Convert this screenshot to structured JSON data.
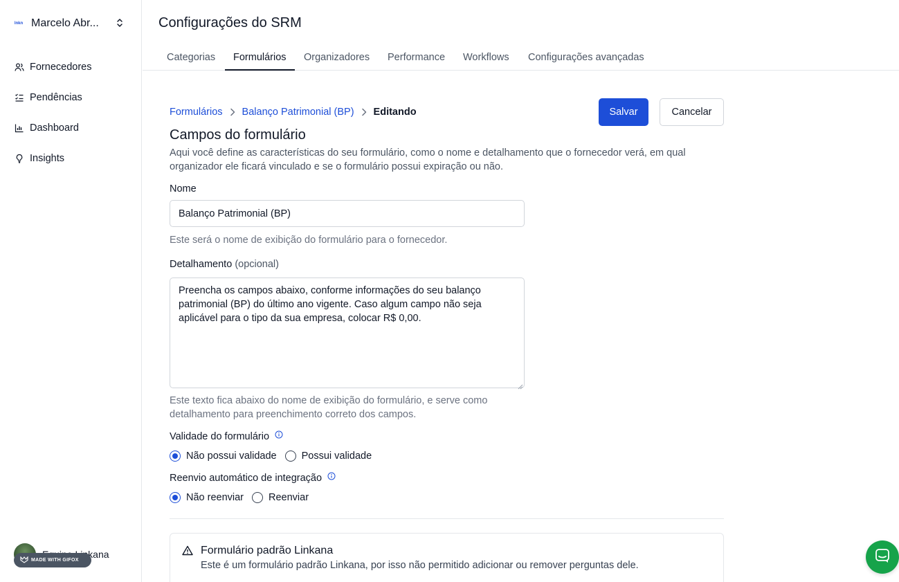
{
  "sidebar": {
    "org": {
      "logo_text": "lnkn",
      "name": "Marcelo Abr..."
    },
    "items": [
      {
        "label": "Fornecedores",
        "icon": "users-icon"
      },
      {
        "label": "Pendências",
        "icon": "list-check-icon"
      },
      {
        "label": "Dashboard",
        "icon": "bar-chart-icon"
      },
      {
        "label": "Insights",
        "icon": "lightbulb-icon"
      }
    ],
    "user": {
      "name": "Equipe Linkana"
    },
    "gifox_badge": "MADE WITH GIFOX"
  },
  "header": {
    "title": "Configurações do SRM",
    "tabs": [
      {
        "label": "Categorias"
      },
      {
        "label": "Formulários",
        "active": true
      },
      {
        "label": "Organizadores"
      },
      {
        "label": "Performance"
      },
      {
        "label": "Workflows"
      },
      {
        "label": "Configurações avançadas"
      }
    ]
  },
  "breadcrumb": {
    "items": [
      "Formulários",
      "Balanço Patrimonial (BP)"
    ],
    "current": "Editando"
  },
  "actions": {
    "save_label": "Salvar",
    "cancel_label": "Cancelar"
  },
  "form": {
    "title": "Campos do formulário",
    "description": "Aqui você define as características do seu formulário, como o nome e detalhamento que o fornecedor verá, em qual organizador ele ficará vinculado e se o formulário possui expiração ou não.",
    "name": {
      "label": "Nome",
      "value": "Balanço Patrimonial (BP)",
      "helper": "Este será o nome de exibição do formulário para o fornecedor."
    },
    "details": {
      "label": "Detalhamento",
      "optional": "(opcional)",
      "value": "Preencha os campos abaixo, conforme informações do seu balanço patrimonial (BP) do último ano vigente. Caso algum campo não seja aplicável para o tipo da sua empresa, colocar R$ 0,00.",
      "helper": "Este texto fica abaixo do nome de exibição do formulário, e serve como detalhamento para preenchimento correto dos campos."
    },
    "validity": {
      "label": "Validade do formulário",
      "options": [
        "Não possui validade",
        "Possui validade"
      ],
      "selected": "Não possui validade"
    },
    "resend": {
      "label": "Reenvio automático de integração",
      "options": [
        "Não reenviar",
        "Reenviar"
      ],
      "selected": "Não reenviar"
    }
  },
  "notice": {
    "title": "Formulário padrão Linkana",
    "text": "Este é um formulário padrão Linkana, por isso não permitido adicionar ou remover perguntas dele."
  },
  "colors": {
    "primary": "#1d4ed8",
    "chat_fab": "#16a34a",
    "border": "#e5e7eb"
  }
}
